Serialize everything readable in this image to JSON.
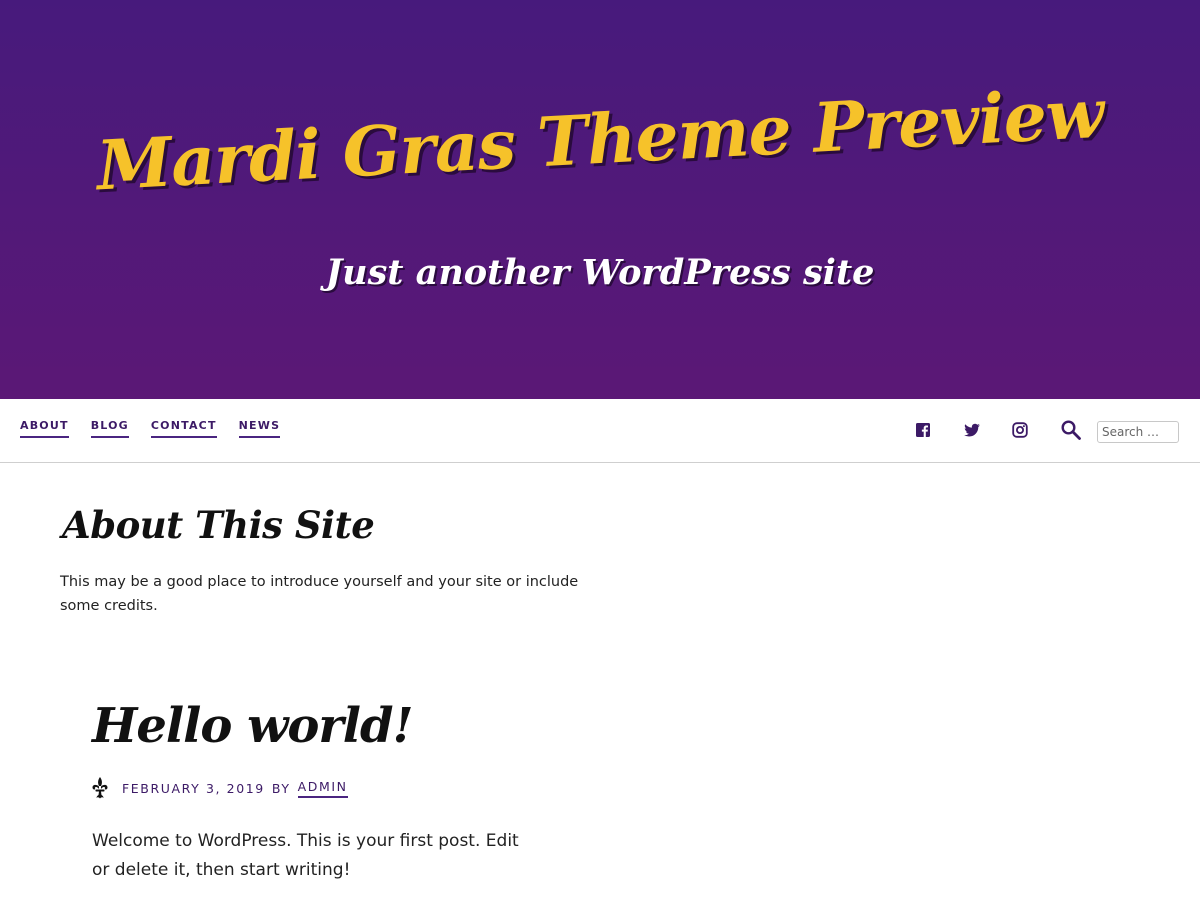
{
  "header": {
    "site_title": "Mardi Gras Theme Preview",
    "site_description": "Just another WordPress site"
  },
  "nav": {
    "items": [
      {
        "label": "ABOUT"
      },
      {
        "label": "BLOG"
      },
      {
        "label": "CONTACT"
      },
      {
        "label": "NEWS"
      }
    ],
    "social_icons": [
      "facebook-icon",
      "twitter-icon",
      "instagram-icon"
    ],
    "search": {
      "icon": "search-icon",
      "placeholder": "Search …"
    }
  },
  "widget": {
    "title": "About This Site",
    "text": "This may be a good place to introduce yourself and your site or include some credits."
  },
  "post": {
    "title": "Hello world!",
    "meta_icon": "fleur-de-lis-icon",
    "date": "FEBRUARY 3, 2019",
    "by": "BY",
    "author": "ADMIN",
    "content": "Welcome to WordPress. This is your first post. Edit or delete it, then start writing!"
  },
  "colors": {
    "header_gradient_top": "#471a7c",
    "header_gradient_bottom": "#5b1876",
    "title_gold": "#f6c22a",
    "link_purple": "#3c1a66"
  }
}
